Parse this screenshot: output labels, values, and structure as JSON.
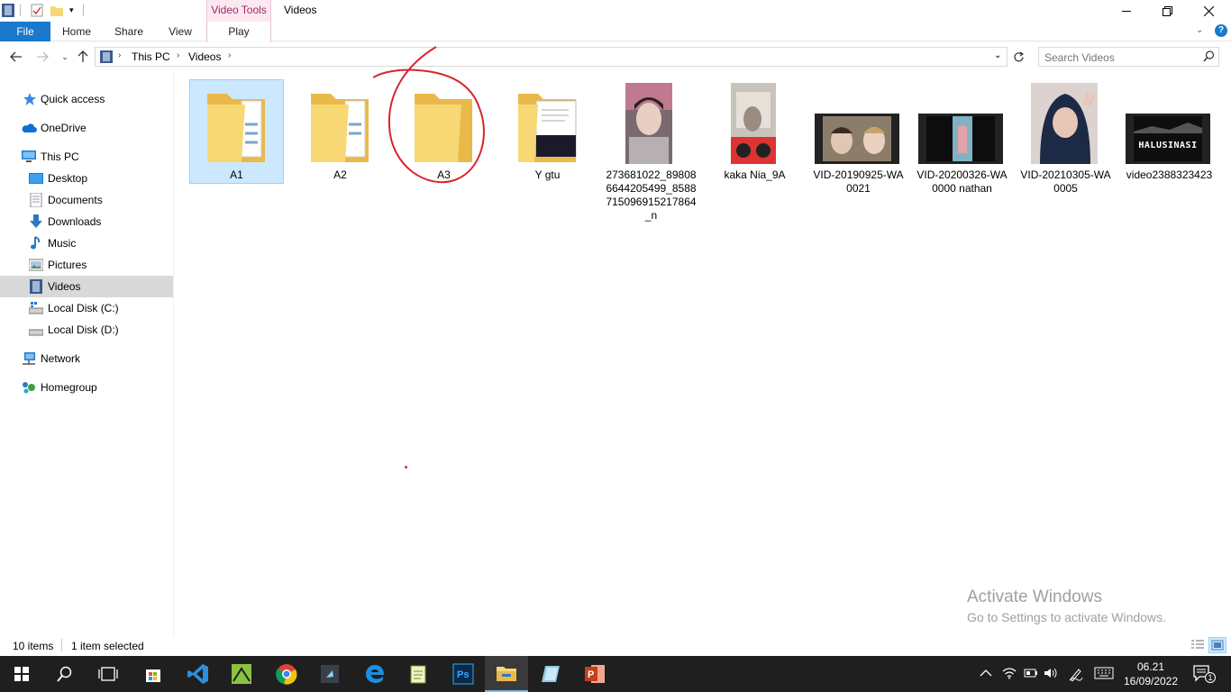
{
  "titlebar": {
    "title": "Videos",
    "contextual_group": "Video Tools",
    "minimize": "—",
    "maximize": "❐",
    "close": "✕"
  },
  "ribbon": {
    "tabs": [
      "File",
      "Home",
      "Share",
      "View",
      "Play"
    ],
    "help_icon": "?"
  },
  "address": {
    "crumbs": [
      "This PC",
      "Videos"
    ],
    "search_placeholder": "Search Videos"
  },
  "navpane": {
    "items": [
      {
        "label": "Quick access",
        "icon": "star-icon"
      },
      {
        "label": "OneDrive",
        "icon": "cloud-icon"
      },
      {
        "label": "This PC",
        "icon": "computer-icon"
      },
      {
        "label": "Desktop",
        "icon": "desktop-icon"
      },
      {
        "label": "Documents",
        "icon": "documents-icon"
      },
      {
        "label": "Downloads",
        "icon": "download-arrow-icon"
      },
      {
        "label": "Music",
        "icon": "music-note-icon"
      },
      {
        "label": "Pictures",
        "icon": "pictures-icon"
      },
      {
        "label": "Videos",
        "icon": "film-icon"
      },
      {
        "label": "Local Disk (C:)",
        "icon": "disk-icon"
      },
      {
        "label": "Local Disk (D:)",
        "icon": "disk-icon"
      },
      {
        "label": "Network",
        "icon": "network-icon"
      },
      {
        "label": "Homegroup",
        "icon": "homegroup-icon"
      }
    ],
    "selected": "Videos"
  },
  "files": [
    {
      "name": "A1",
      "type": "folder",
      "selected": true
    },
    {
      "name": "A2",
      "type": "folder"
    },
    {
      "name": "A3",
      "type": "folder"
    },
    {
      "name": "Y gtu",
      "type": "folder"
    },
    {
      "name": "273681022_898086644205499_8588715096915217864_n",
      "type": "video"
    },
    {
      "name": "kaka Nia_9A",
      "type": "video"
    },
    {
      "name": "VID-20190925-WA0021",
      "type": "video"
    },
    {
      "name": "VID-20200326-WA0000 nathan",
      "type": "video"
    },
    {
      "name": "VID-20210305-WA0005",
      "type": "video"
    },
    {
      "name": "video2388323423",
      "type": "video",
      "thumb_text": "HALUSINASI"
    }
  ],
  "status": {
    "count": "10 items",
    "selection": "1 item selected"
  },
  "watermark": {
    "line1": "Activate Windows",
    "line2": "Go to Settings to activate Windows."
  },
  "clock": {
    "time": "06.21",
    "date": "16/09/2022"
  },
  "notifications_count": "1"
}
